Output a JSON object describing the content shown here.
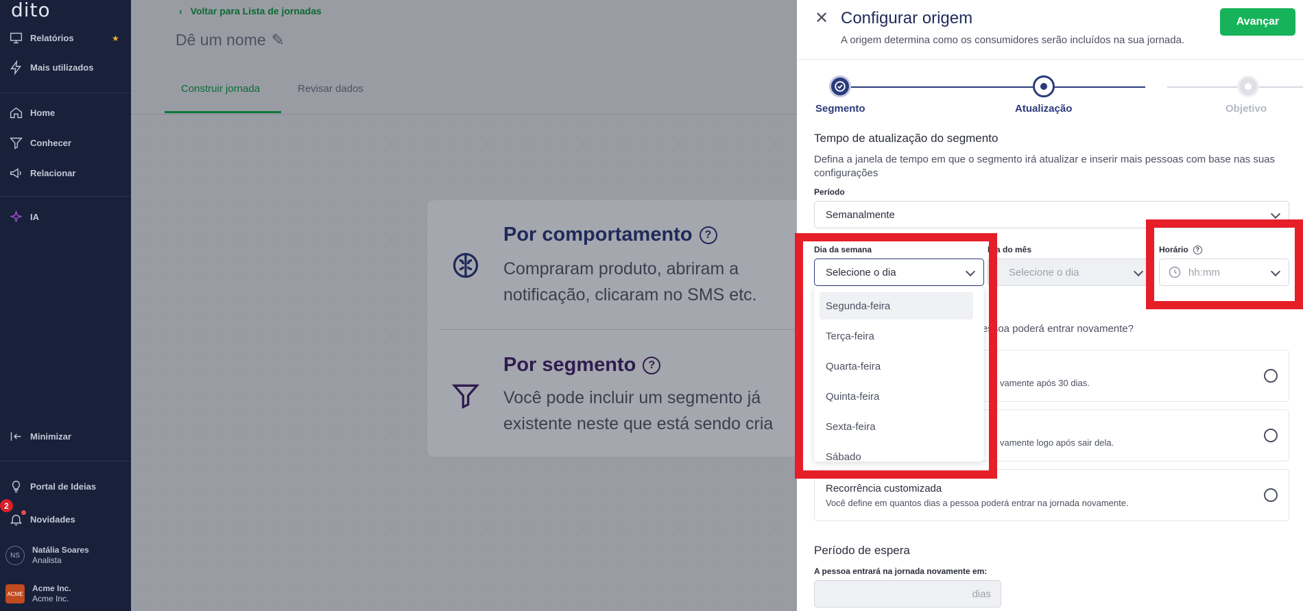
{
  "sidebar": {
    "logo": "dito",
    "items": [
      {
        "label": "Relatórios"
      },
      {
        "label": "Mais utilizados"
      },
      {
        "label": "Home"
      },
      {
        "label": "Conhecer"
      },
      {
        "label": "Relacionar"
      },
      {
        "label": "IA"
      }
    ],
    "minimize": "Minimizar",
    "ideas": "Portal de Ideias",
    "news": "Novidades",
    "news_badge": "2",
    "user": {
      "initials": "NS",
      "name": "Natália Soares",
      "role": "Analista"
    },
    "org": {
      "initials": "ACME",
      "name": "Acme Inc.",
      "sub": "Acme Inc."
    }
  },
  "main": {
    "back": "Voltar para Lista de jornadas",
    "journey_name": "Dê um nome",
    "tabs": [
      {
        "label": "Construir jornada"
      },
      {
        "label": "Revisar dados"
      }
    ],
    "options": [
      {
        "title": "Por comportamento",
        "desc": "Compraram produto, abriram a notificação, clicaram no SMS etc."
      },
      {
        "title": "Por segmento",
        "desc": "Você pode incluir um segmento já existente neste que está sendo cria"
      }
    ]
  },
  "panel": {
    "title": "Configurar origem",
    "subtitle": "A origem determina como os consumidores serão incluídos na sua jornada.",
    "next": "Avançar",
    "steps": [
      {
        "label": "Segmento"
      },
      {
        "label": "Atualização"
      },
      {
        "label": "Objetivo"
      }
    ],
    "section_title": "Tempo de atualização do segmento",
    "section_desc": "Defina a janela de tempo em que o segmento irá atualizar e inserir mais pessoas com base nas suas configurações",
    "period_label": "Período",
    "period_value": "Semanalmente",
    "weekday_label": "Dia da semana",
    "weekday_placeholder": "Selecione o dia",
    "monthday_label": "Dia do mês",
    "monthday_placeholder": "Selecione o dia",
    "time_label": "Horário",
    "time_placeholder": "hh:mm",
    "weekday_options": [
      "Segunda-feira",
      "Terça-feira",
      "Quarta-feira",
      "Quinta-feira",
      "Sexta-feira",
      "Sábado"
    ],
    "reentry_question": "essoa poderá entrar novamente?",
    "recurrence": [
      {
        "title": "",
        "desc": "vamente após 30 dias."
      },
      {
        "title": "",
        "desc": "vamente logo após sair dela."
      },
      {
        "title": "Recorrência customizada",
        "desc": "Você define em quantos dias a pessoa poderá entrar na jornada novamente."
      }
    ],
    "wait_title": "Período de espera",
    "wait_label": "A pessoa entrará na jornada novamente em:",
    "wait_suffix": "dias"
  }
}
